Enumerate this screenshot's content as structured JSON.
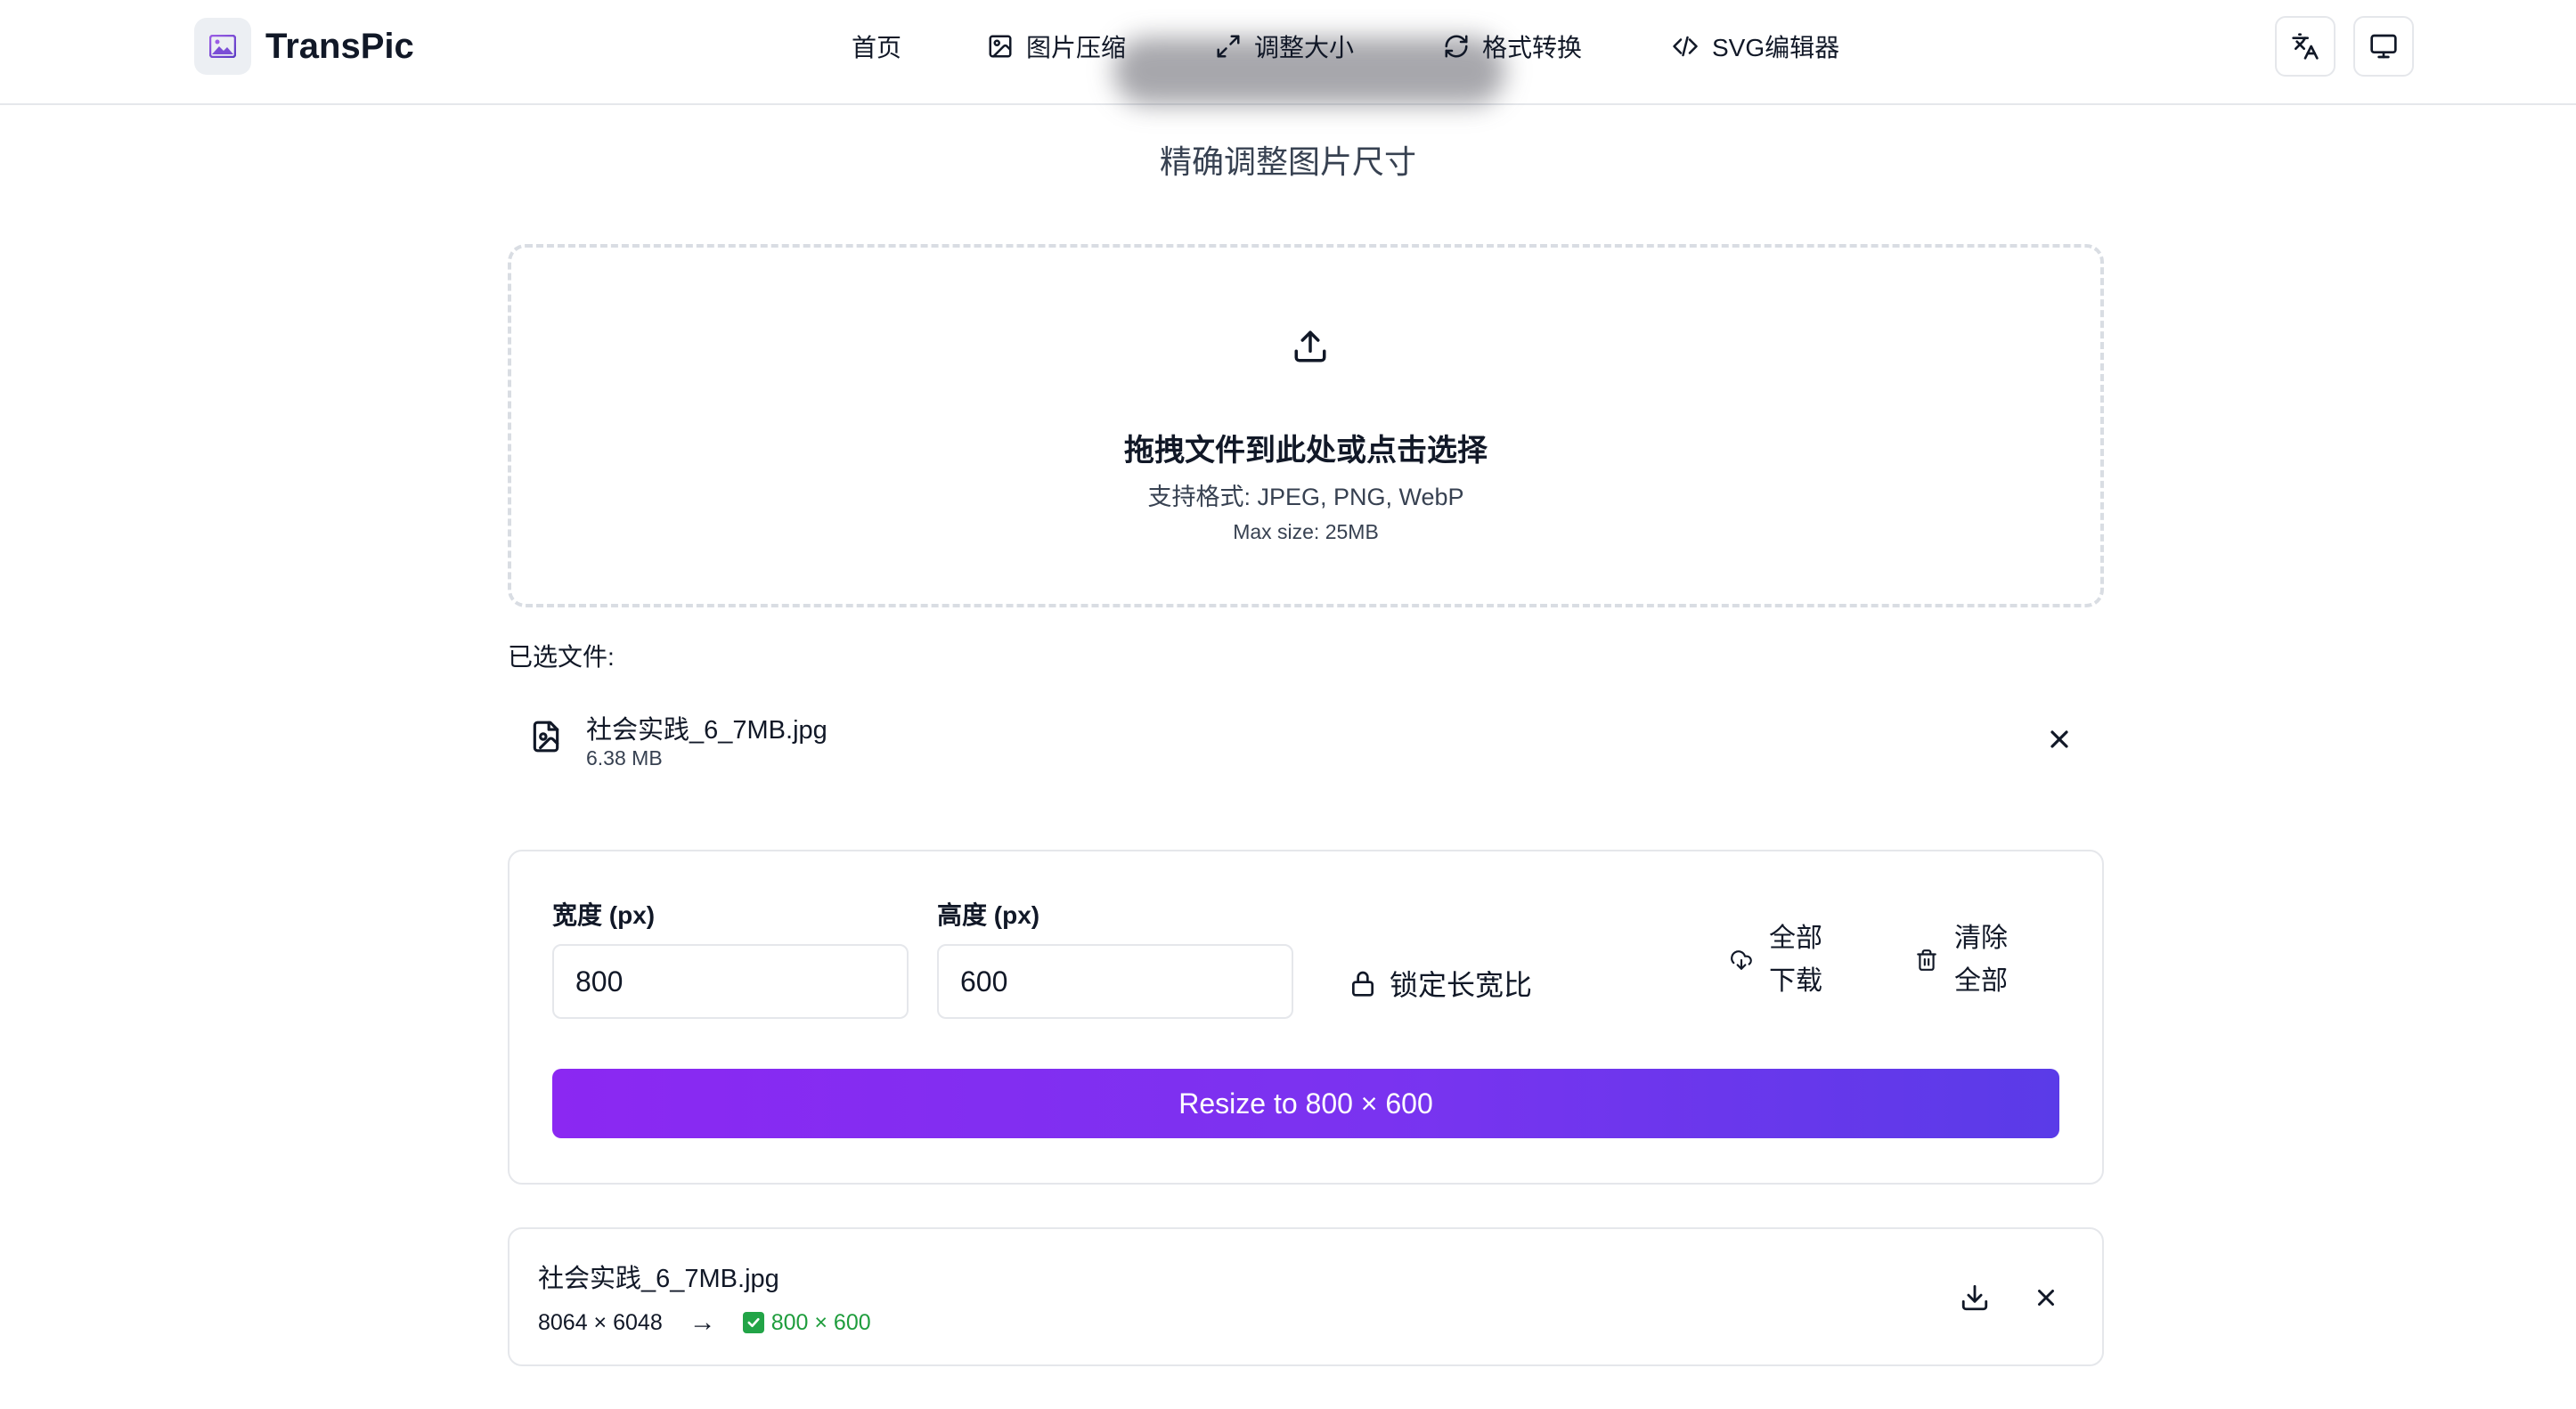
{
  "brand": {
    "name": "TransPic",
    "logo_icon": "image-icon"
  },
  "nav": {
    "items": [
      {
        "label": "首页",
        "icon": ""
      },
      {
        "label": "图片压缩",
        "icon": "image-icon"
      },
      {
        "label": "调整大小",
        "icon": "expand-arrows-icon"
      },
      {
        "label": "格式转换",
        "icon": "refresh-icon"
      },
      {
        "label": "SVG编辑器",
        "icon": "code-icon"
      }
    ]
  },
  "header_actions": {
    "language_icon": "translate-icon",
    "theme_icon": "monitor-icon"
  },
  "page": {
    "subtitle": "精确调整图片尺寸"
  },
  "dropzone": {
    "title": "拖拽文件到此处或点击选择",
    "formats": "支持格式: JPEG, PNG, WebP",
    "max_size": "Max size: 25MB",
    "icon": "upload-icon"
  },
  "selected_files": {
    "label": "已选文件:",
    "files": [
      {
        "name": "社会实践_6_7MB.jpg",
        "size": "6.38 MB"
      }
    ]
  },
  "options": {
    "width_label": "宽度 (px)",
    "width_value": "800",
    "height_label": "高度 (px)",
    "height_value": "600",
    "lock_label": "锁定长宽比",
    "download_all": "全部下载",
    "clear_all": "清除全部",
    "resize_button": "Resize to 800 × 600"
  },
  "results": [
    {
      "name": "社会实践_6_7MB.jpg",
      "original": "8064 × 6048",
      "arrow": "→",
      "new_size": "800 × 600"
    }
  ],
  "colors": {
    "accent_start": "#8b28f2",
    "accent_end": "#5a3be8",
    "success": "#1f9d3d"
  }
}
